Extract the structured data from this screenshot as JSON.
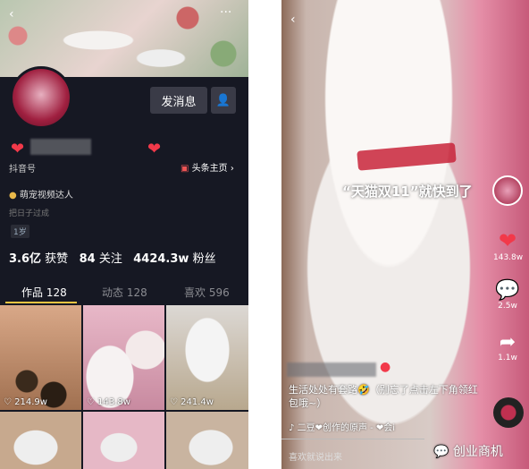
{
  "profile": {
    "douyin_id_label": "抖音号",
    "toutiao_link": "头条主页",
    "message_button": "发消息",
    "category": "萌宠视频达人",
    "bio": "把日子过成",
    "age_tag": "1岁",
    "stats": {
      "likes_value": "3.6亿",
      "likes_label": "获赞",
      "following_value": "84",
      "following_label": "关注",
      "followers_value": "4424.3w",
      "followers_label": "粉丝"
    },
    "tabs": [
      {
        "label": "作品 128"
      },
      {
        "label": "动态 128"
      },
      {
        "label": "喜欢 596"
      }
    ],
    "videos": [
      {
        "likes": "214.9w"
      },
      {
        "likes": "143.8w"
      },
      {
        "likes": "241.4w"
      }
    ]
  },
  "video": {
    "overlay_text": "“天猫双11”就快到了",
    "like_count": "143.8w",
    "comment_count": "2.5w",
    "share_count": "1.1w",
    "caption": "生活处处有套路🤣（别忘了点击左下角领红包哦~）",
    "music": "二豆❤创作的原声 - ❤会i",
    "comment_placeholder": "喜欢就说出来"
  },
  "watermark": "创业商机",
  "colors": {
    "bg": "#161823",
    "accent": "#f2394a"
  }
}
